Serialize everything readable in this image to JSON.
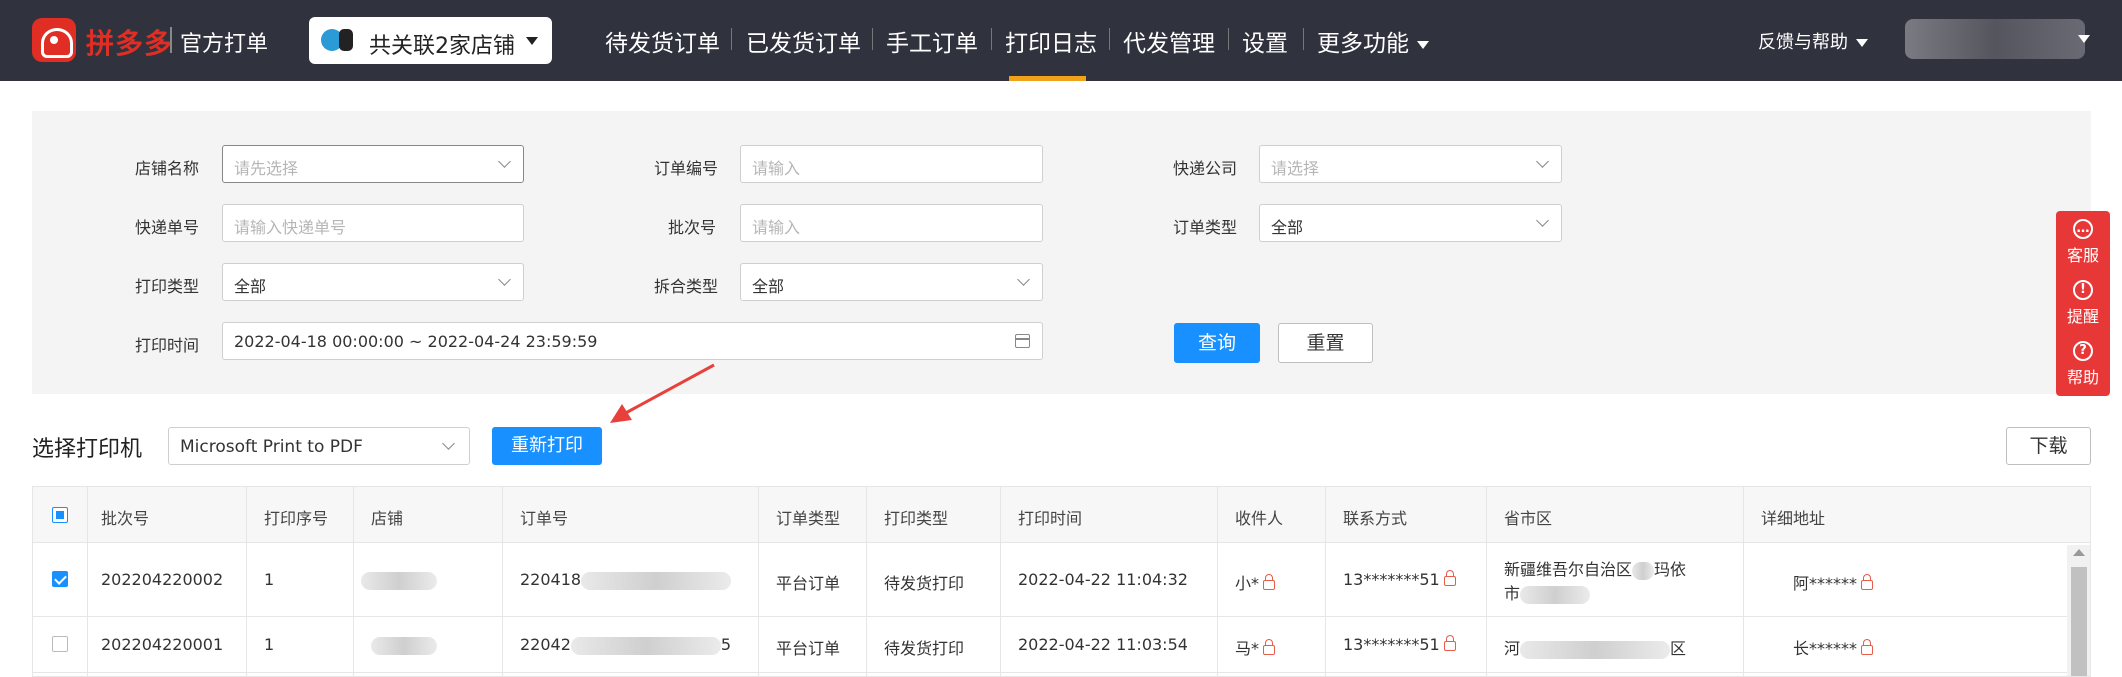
{
  "nav": {
    "brand": "拼多多",
    "brand_sub": "官方打单",
    "shop_select": "共关联2家店铺",
    "items": [
      "待发货订单",
      "已发货订单",
      "手工订单",
      "打印日志",
      "代发管理",
      "设置",
      "更多功能"
    ],
    "active": "打印日志",
    "help": "反馈与帮助"
  },
  "filters": {
    "shop_name": {
      "label": "店铺名称",
      "placeholder": "请先选择"
    },
    "order_no": {
      "label": "订单编号",
      "placeholder": "请输入"
    },
    "express_company": {
      "label": "快递公司",
      "placeholder": "请选择"
    },
    "tracking_no": {
      "label": "快递单号",
      "placeholder": "请输入快递单号"
    },
    "batch_no": {
      "label": "批次号",
      "placeholder": "请输入"
    },
    "order_type": {
      "label": "订单类型",
      "value": "全部"
    },
    "print_type": {
      "label": "打印类型",
      "value": "全部"
    },
    "split_merge_type": {
      "label": "拆合类型",
      "value": "全部"
    },
    "print_time": {
      "label": "打印时间",
      "value": "2022-04-18 00:00:00 ~ 2022-04-24 23:59:59"
    },
    "query_button": "查询",
    "reset_button": "重置"
  },
  "float_panel": {
    "items": [
      {
        "label": "客服",
        "icon": "chat-icon",
        "glyph": "…"
      },
      {
        "label": "提醒",
        "icon": "alert-icon",
        "glyph": "!"
      },
      {
        "label": "帮助",
        "icon": "help-icon",
        "glyph": "?"
      }
    ]
  },
  "printer": {
    "label": "选择打印机",
    "selected": "Microsoft Print to PDF",
    "reprint_button": "重新打印",
    "download_button": "下载"
  },
  "table": {
    "columns": [
      "批次号",
      "打印序号",
      "店铺",
      "订单号",
      "订单类型",
      "打印类型",
      "打印时间",
      "收件人",
      "联系方式",
      "省市区",
      "详细地址"
    ],
    "rows": [
      {
        "checked": true,
        "batch_no": "202204220002",
        "print_seq": "1",
        "order_no": "220418",
        "order_type": "平台订单",
        "print_type": "待发货打印",
        "print_time": "2022-04-22 11:04:32",
        "receiver": "小*",
        "phone": "13*******51",
        "region_a": "新疆维吾尔自治区",
        "region_tail_a": "玛依",
        "region_b": "市",
        "address": "阿******"
      },
      {
        "checked": false,
        "batch_no": "202204220001",
        "print_seq": "1",
        "order_no": "22042",
        "order_no_tail": "5",
        "order_type": "平台订单",
        "print_type": "待发货打印",
        "print_time": "2022-04-22 11:03:54",
        "receiver": "马*",
        "phone": "13*******51",
        "region_a": "河",
        "region_tail_a": "区",
        "address": "长******"
      }
    ]
  },
  "colors": {
    "nav_bg": "#30323e",
    "brand_red": "#e02e24",
    "active_underline": "#f0a21b",
    "primary": "#1890ff",
    "float_red": "#e83737",
    "annotation_arrow": "#e8413b"
  }
}
